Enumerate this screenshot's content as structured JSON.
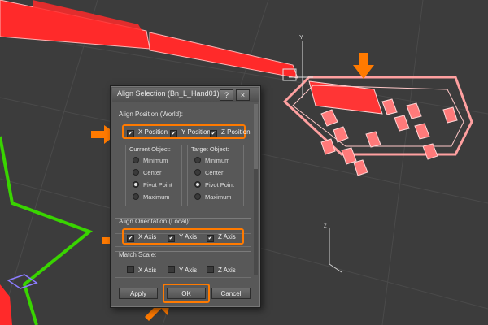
{
  "dialog": {
    "title": "Align Selection (Bn_L_Hand01)",
    "help_label": "?",
    "close_label": "×",
    "align_position": {
      "label": "Align Position (World):",
      "x_label": "X Position",
      "y_label": "Y Position",
      "z_label": "Z Position",
      "x_checked": true,
      "y_checked": true,
      "z_checked": true
    },
    "current_object": {
      "label": "Current Object:",
      "options": [
        "Minimum",
        "Center",
        "Pivot Point",
        "Maximum"
      ],
      "selected": "Pivot Point"
    },
    "target_object": {
      "label": "Target Object:",
      "options": [
        "Minimum",
        "Center",
        "Pivot Point",
        "Maximum"
      ],
      "selected": "Pivot Point"
    },
    "align_orientation": {
      "label": "Align Orientation (Local):",
      "x_label": "X Axis",
      "y_label": "Y Axis",
      "z_label": "Z Axis",
      "x_checked": true,
      "y_checked": true,
      "z_checked": true
    },
    "match_scale": {
      "label": "Match Scale:",
      "x_label": "X Axis",
      "y_label": "Y Axis",
      "z_label": "Z Axis",
      "x_checked": false,
      "y_checked": false,
      "z_checked": false
    },
    "buttons": {
      "apply": "Apply",
      "ok": "OK",
      "cancel": "Cancel"
    }
  },
  "viewport": {
    "axis_label_y": "Y",
    "axis_label_z": "Z"
  },
  "colors": {
    "highlight": "#ff7a00",
    "bone_red": "#ff2a2a",
    "hand_pink": "#ff8c8c",
    "spline_green": "#39d400",
    "background": "#3c3c3c"
  }
}
